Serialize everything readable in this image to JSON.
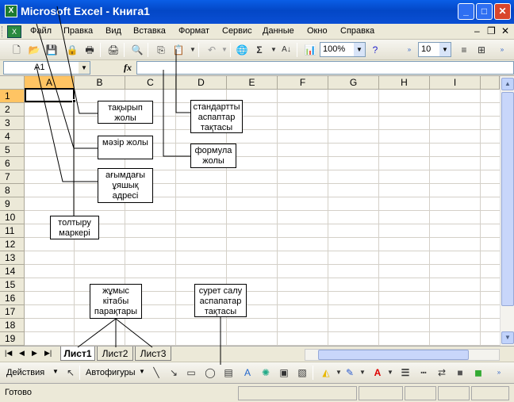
{
  "window": {
    "title": "Microsoft Excel - Книга1",
    "app_icon": "excel-icon"
  },
  "menu": {
    "items": [
      "Файл",
      "Правка",
      "Вид",
      "Вставка",
      "Формат",
      "Сервис",
      "Данные",
      "Окно",
      "Справка"
    ]
  },
  "standard_toolbar": {
    "zoom": "100%",
    "font_size": "10"
  },
  "formula_bar": {
    "name_box": "A1",
    "fx_label": "fx",
    "value": ""
  },
  "grid": {
    "columns": [
      "A",
      "B",
      "C",
      "D",
      "E",
      "F",
      "G",
      "H",
      "I"
    ],
    "rows": [
      "1",
      "2",
      "3",
      "4",
      "5",
      "6",
      "7",
      "8",
      "9",
      "10",
      "11",
      "12",
      "13",
      "14",
      "15",
      "16",
      "17",
      "18",
      "19"
    ],
    "active_cell": "A1"
  },
  "sheet_tabs": [
    "Лист1",
    "Лист2",
    "Лист3"
  ],
  "drawing_toolbar": {
    "actions_label": "Действия",
    "autoshapes_label": "Автофигуры"
  },
  "status": {
    "text": "Готово"
  },
  "callouts": {
    "title_bar": "тақырып жолы",
    "menu_bar": "мәзір жолы",
    "current_cell": "ағымдағы ұяшық адресі",
    "fill_handle": "толтыру маркері",
    "standard_toolbar": "стандартты аспаптар тақтасы",
    "formula_bar": "формула жолы",
    "workbook_sheets": "жұмыс кітабы парақтары",
    "drawing_toolbar": "сурет салу аспапатар тақтасы"
  }
}
